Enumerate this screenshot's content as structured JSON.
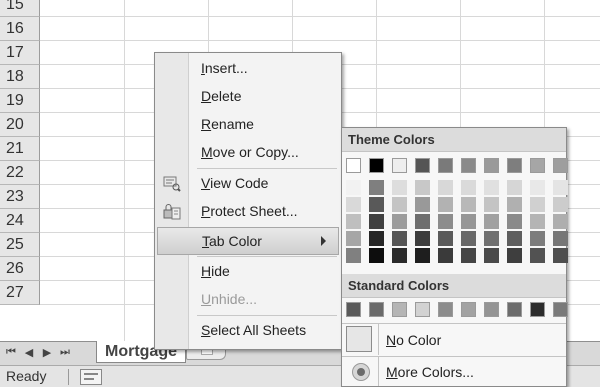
{
  "rows": [
    "15",
    "16",
    "17",
    "18",
    "19",
    "20",
    "21",
    "22",
    "23",
    "24",
    "25",
    "26",
    "27"
  ],
  "sheet_tab": {
    "name": "Mortgage",
    "nav": [
      "⏮",
      "◀",
      "▶",
      "⏭"
    ]
  },
  "status": {
    "text": "Ready"
  },
  "context_menu": {
    "items": [
      {
        "ul": "I",
        "rest": "nsert...",
        "name": "menu-insert",
        "icon": ""
      },
      {
        "ul": "D",
        "rest": "elete",
        "name": "menu-delete",
        "icon": ""
      },
      {
        "ul": "R",
        "rest": "ename",
        "name": "menu-rename",
        "icon": ""
      },
      {
        "ul": "M",
        "rest": "ove or Copy...",
        "name": "menu-move-or-copy",
        "icon": ""
      },
      {
        "ul": "V",
        "rest": "iew Code",
        "name": "menu-view-code",
        "icon": "view-code-icon"
      },
      {
        "ul": "P",
        "rest": "rotect Sheet...",
        "name": "menu-protect-sheet",
        "icon": "protect-sheet-icon"
      },
      {
        "ul": "T",
        "rest": "ab Color",
        "name": "menu-tab-color",
        "icon": "",
        "submenu": true,
        "highlighted": true
      },
      {
        "ul": "H",
        "rest": "ide",
        "name": "menu-hide",
        "icon": ""
      },
      {
        "ul": "U",
        "rest": "nhide...",
        "name": "menu-unhide",
        "icon": "",
        "disabled": true
      },
      {
        "ul": "S",
        "rest": "elect All Sheets",
        "name": "menu-select-all-sheets",
        "icon": ""
      }
    ]
  },
  "tab_color": {
    "theme_label": "Theme Colors",
    "standard_label": "Standard Colors",
    "no_color": {
      "ul": "N",
      "rest": "o Color"
    },
    "more_colors": {
      "ul": "M",
      "rest": "ore Colors..."
    },
    "theme_base": [
      "#ffffff",
      "#000000",
      "#eeeeee",
      "#555555",
      "#7a7a7a",
      "#8a8a8a",
      "#9a9a9a",
      "#7e7e7e",
      "#a6a6a6",
      "#9e9e9e"
    ],
    "theme_shades": [
      [
        "#f2f2f2",
        "#d9d9d9",
        "#bfbfbf",
        "#a6a6a6",
        "#808080"
      ],
      [
        "#7f7f7f",
        "#595959",
        "#404040",
        "#262626",
        "#0d0d0d"
      ],
      [
        "#dddddd",
        "#c4c4c4",
        "#9c9c9c",
        "#555555",
        "#2a2a2a"
      ],
      [
        "#c8c8c8",
        "#999999",
        "#6e6e6e",
        "#3c3c3c",
        "#1e1e1e"
      ],
      [
        "#d8d8d8",
        "#b2b2b2",
        "#8c8c8c",
        "#5a5a5a",
        "#3a3a3a"
      ],
      [
        "#dadada",
        "#b8b8b8",
        "#969696",
        "#686868",
        "#454545"
      ],
      [
        "#e0e0e0",
        "#c4c4c4",
        "#a0a0a0",
        "#707070",
        "#4a4a4a"
      ],
      [
        "#d6d6d6",
        "#b0b0b0",
        "#8a8a8a",
        "#5e5e5e",
        "#3e3e3e"
      ],
      [
        "#e8e8e8",
        "#d0d0d0",
        "#b4b4b4",
        "#7c7c7c",
        "#525252"
      ],
      [
        "#e4e4e4",
        "#cccccc",
        "#aeaeae",
        "#767676",
        "#4e4e4e"
      ]
    ],
    "standard": [
      "#5a5a5a",
      "#6a6a6a",
      "#b5b5b5",
      "#d2d2d2",
      "#8c8c8c",
      "#a2a2a2",
      "#949494",
      "#6c6c6c",
      "#2c2c2c",
      "#7a7a7a"
    ]
  }
}
